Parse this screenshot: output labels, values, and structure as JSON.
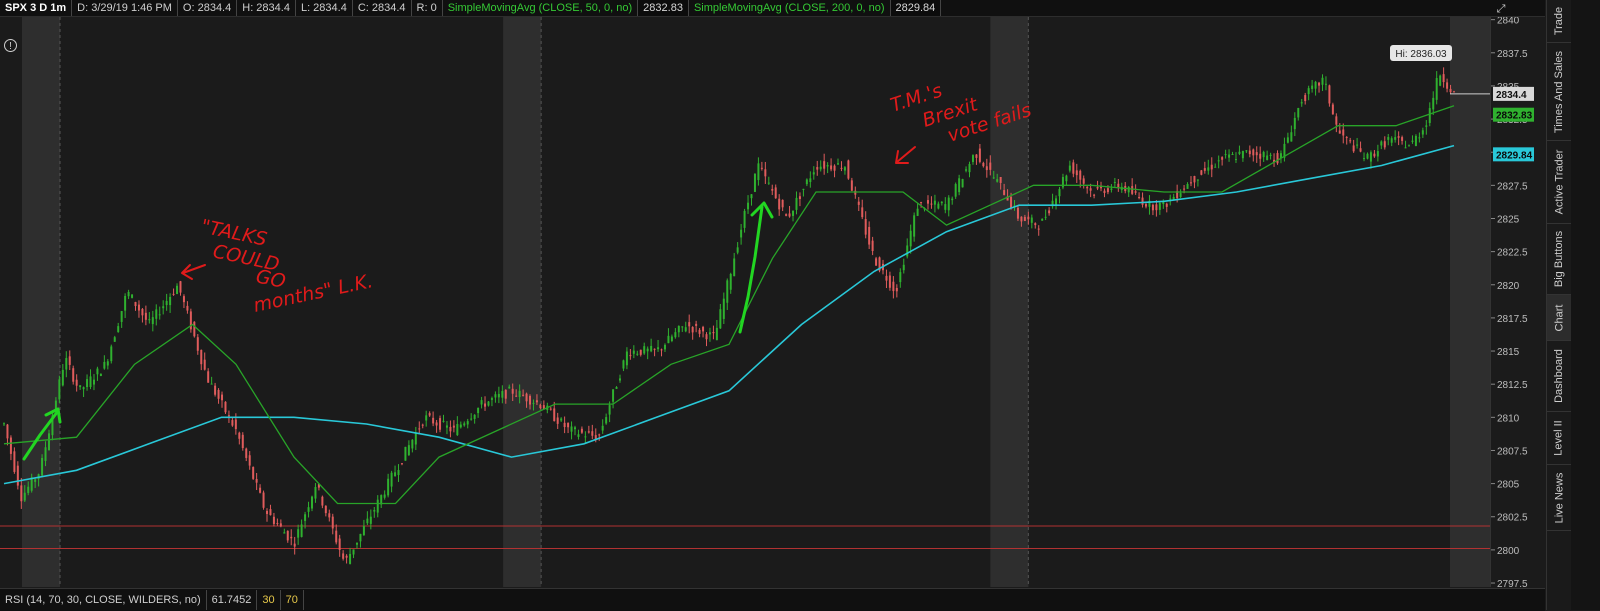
{
  "header": {
    "symbol": "SPX 3 D 1m",
    "date": "D: 3/29/19 1:46 PM",
    "open": "O: 2834.4",
    "high": "H: 2834.4",
    "low": "L: 2834.4",
    "close": "C: 2834.4",
    "range": "R: 0",
    "sma50_label": "SimpleMovingAvg (CLOSE, 50, 0, no)",
    "sma50_value": "2832.83",
    "sma200_label": "SimpleMovingAvg (CLOSE, 200, 0, no)",
    "sma200_value": "2829.84"
  },
  "footer": {
    "rsi_label": "RSI (14, 70, 30, CLOSE, WILDERS, no)",
    "rsi_value": "61.7452",
    "oversold": "30",
    "overbought": "70"
  },
  "sidebar": {
    "tabs": [
      "Trade",
      "Times And Sales",
      "Active Trader",
      "Big Buttons",
      "Chart",
      "Dashboard",
      "Level II",
      "Live News"
    ],
    "active": "Chart"
  },
  "colors": {
    "up": "#2fb12f",
    "down": "#e05c5c",
    "sma50": "#28a428",
    "sma200": "#29c8d8",
    "support": "#b23232",
    "annotation_red": "#e01b1b",
    "annotation_green": "#22d622"
  },
  "chart_data": {
    "type": "candlestick",
    "y_ticks": [
      "2797.5",
      "2800",
      "2802.5",
      "2805",
      "2807.5",
      "2810",
      "2812.5",
      "2815",
      "2817.5",
      "2820",
      "2822.5",
      "2825",
      "2827.5",
      "2830",
      "2832.5",
      "2835",
      "2837.5",
      "2840"
    ],
    "ylim": [
      2797.2,
      2840.2
    ],
    "grid": false,
    "last_price": "2834.4",
    "high_label": "Hi: 2836.03",
    "sma50_marker": "2832.83",
    "sma200_marker": "2829.84",
    "support_levels": [
      2801.8,
      2800.1
    ],
    "price_path": [
      [
        0,
        2809.5
      ],
      [
        0.012,
        2804
      ],
      [
        0.025,
        2806
      ],
      [
        0.042,
        2814.5
      ],
      [
        0.052,
        2812
      ],
      [
        0.07,
        2814
      ],
      [
        0.085,
        2819.5
      ],
      [
        0.1,
        2817
      ],
      [
        0.12,
        2820
      ],
      [
        0.14,
        2813
      ],
      [
        0.16,
        2809
      ],
      [
        0.18,
        2803
      ],
      [
        0.2,
        2800.5
      ],
      [
        0.215,
        2805
      ],
      [
        0.235,
        2799
      ],
      [
        0.25,
        2802
      ],
      [
        0.27,
        2806
      ],
      [
        0.29,
        2810
      ],
      [
        0.31,
        2809
      ],
      [
        0.33,
        2811
      ],
      [
        0.35,
        2812
      ],
      [
        0.37,
        2811
      ],
      [
        0.39,
        2809
      ],
      [
        0.41,
        2808.5
      ],
      [
        0.43,
        2815
      ],
      [
        0.45,
        2815
      ],
      [
        0.47,
        2817
      ],
      [
        0.49,
        2816
      ],
      [
        0.51,
        2825
      ],
      [
        0.52,
        2829
      ],
      [
        0.54,
        2825
      ],
      [
        0.56,
        2829
      ],
      [
        0.58,
        2829
      ],
      [
        0.6,
        2822
      ],
      [
        0.615,
        2819.5
      ],
      [
        0.63,
        2826
      ],
      [
        0.65,
        2826
      ],
      [
        0.67,
        2830
      ],
      [
        0.69,
        2827
      ],
      [
        0.7,
        2825
      ],
      [
        0.715,
        2824.5
      ],
      [
        0.735,
        2829
      ],
      [
        0.75,
        2827
      ],
      [
        0.77,
        2827.5
      ],
      [
        0.79,
        2826
      ],
      [
        0.8,
        2826
      ],
      [
        0.82,
        2828
      ],
      [
        0.84,
        2829.5
      ],
      [
        0.86,
        2830
      ],
      [
        0.88,
        2829.5
      ],
      [
        0.895,
        2834
      ],
      [
        0.91,
        2835.5
      ],
      [
        0.92,
        2831.5
      ],
      [
        0.94,
        2829.5
      ],
      [
        0.955,
        2831
      ],
      [
        0.97,
        2830.5
      ],
      [
        0.98,
        2832
      ],
      [
        0.99,
        2836
      ],
      [
        1.0,
        2834.4
      ]
    ],
    "sma50_path": [
      [
        0,
        2808
      ],
      [
        0.05,
        2808.5
      ],
      [
        0.09,
        2814
      ],
      [
        0.13,
        2817
      ],
      [
        0.16,
        2814
      ],
      [
        0.2,
        2807
      ],
      [
        0.23,
        2803.5
      ],
      [
        0.27,
        2803.5
      ],
      [
        0.3,
        2807
      ],
      [
        0.34,
        2809
      ],
      [
        0.38,
        2811
      ],
      [
        0.42,
        2811
      ],
      [
        0.46,
        2814
      ],
      [
        0.5,
        2815.5
      ],
      [
        0.53,
        2822
      ],
      [
        0.56,
        2827
      ],
      [
        0.59,
        2827
      ],
      [
        0.62,
        2827
      ],
      [
        0.65,
        2824.5
      ],
      [
        0.68,
        2826
      ],
      [
        0.71,
        2827.5
      ],
      [
        0.75,
        2827.5
      ],
      [
        0.8,
        2827
      ],
      [
        0.84,
        2827
      ],
      [
        0.88,
        2829.5
      ],
      [
        0.92,
        2832
      ],
      [
        0.96,
        2832
      ],
      [
        1.0,
        2833.5
      ]
    ],
    "sma200_path": [
      [
        0,
        2805
      ],
      [
        0.05,
        2806
      ],
      [
        0.1,
        2808
      ],
      [
        0.15,
        2810
      ],
      [
        0.2,
        2810
      ],
      [
        0.25,
        2809.5
      ],
      [
        0.3,
        2808.5
      ],
      [
        0.35,
        2807
      ],
      [
        0.4,
        2808
      ],
      [
        0.45,
        2810
      ],
      [
        0.5,
        2812
      ],
      [
        0.55,
        2817
      ],
      [
        0.6,
        2821
      ],
      [
        0.65,
        2824
      ],
      [
        0.7,
        2826
      ],
      [
        0.75,
        2826
      ],
      [
        0.8,
        2826.3
      ],
      [
        0.85,
        2827
      ],
      [
        0.9,
        2828
      ],
      [
        0.95,
        2829
      ],
      [
        1.0,
        2830.5
      ]
    ],
    "sessions": [
      [
        0,
        0.347
      ],
      [
        0.347,
        0.683
      ],
      [
        0.683,
        1.0
      ]
    ],
    "annotations": [
      {
        "text_lines": [
          "\"TALKS",
          "COULD",
          "GO",
          "months\" L.K."
        ]
      },
      {
        "text_lines": [
          "T.M.'s",
          "Brexit",
          "vote fails"
        ]
      }
    ]
  }
}
